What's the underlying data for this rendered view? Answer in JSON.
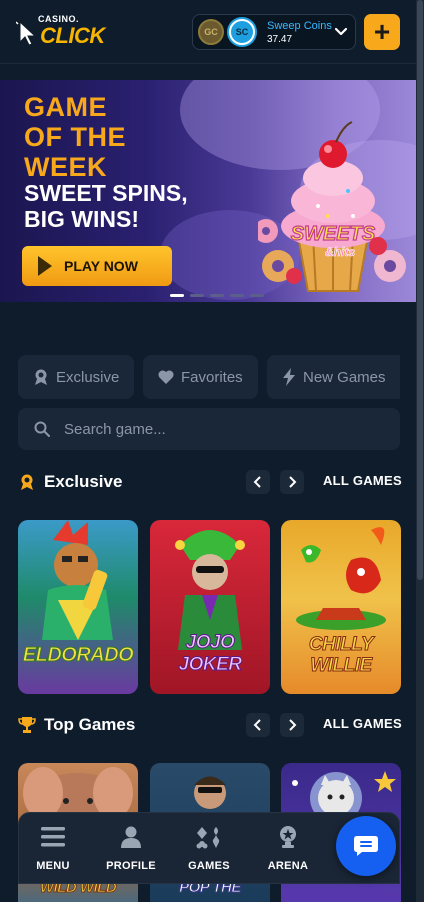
{
  "header": {
    "logo_top": "CASINO.",
    "logo_main": "CLICK",
    "gc_label": "GC",
    "sc_label": "SC",
    "wallet_label": "Sweep Coins",
    "wallet_value": "37.47",
    "add_label": "+"
  },
  "banner": {
    "heading_lines": [
      "GAME",
      "OF THE",
      "WEEK"
    ],
    "subheading_lines": [
      "SWEET SPINS,",
      "BIG WINS!"
    ],
    "cta": "PLAY NOW",
    "game_logo_line1": "SWEETS",
    "game_logo_line2": "&hits",
    "slides": 5,
    "active_slide": 1
  },
  "filters": [
    {
      "label": "Exclusive",
      "icon": "badge-icon"
    },
    {
      "label": "Favorites",
      "icon": "heart-icon"
    },
    {
      "label": "New Games",
      "icon": "lightning-icon"
    }
  ],
  "search": {
    "placeholder": "Search game..."
  },
  "sections": {
    "exclusive": {
      "title": "Exclusive",
      "all_label": "ALL GAMES",
      "games": [
        {
          "title": "ELDORADO"
        },
        {
          "title": "JOJO JOKER",
          "title_line1": "JOJO",
          "title_line2": "JOKER"
        },
        {
          "title": "CHILLY WILLIE",
          "title_line1": "CHILLY",
          "title_line2": "WILLIE"
        }
      ]
    },
    "top": {
      "title": "Top Games",
      "all_label": "ALL GAMES",
      "games": [
        {
          "title": "WILD WILD"
        },
        {
          "title": "POP THE"
        },
        {
          "title": ""
        }
      ]
    }
  },
  "bottom_nav": [
    {
      "label": "MENU",
      "icon": "menu-icon"
    },
    {
      "label": "PROFILE",
      "icon": "profile-icon"
    },
    {
      "label": "GAMES",
      "icon": "cards-icon"
    },
    {
      "label": "ARENA",
      "icon": "trophy-icon"
    }
  ],
  "colors": {
    "background": "#0f1c2c",
    "accent": "#f7a81b",
    "sweep_coin": "#39b9ff",
    "chat_button": "#1560f0"
  }
}
